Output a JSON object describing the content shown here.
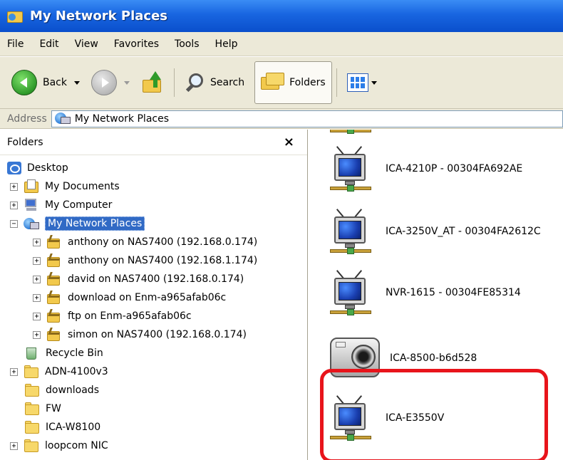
{
  "window": {
    "title": "My Network Places"
  },
  "menu": {
    "items": [
      "File",
      "Edit",
      "View",
      "Favorites",
      "Tools",
      "Help"
    ]
  },
  "toolbar": {
    "back_label": "Back",
    "search_label": "Search",
    "folders_label": "Folders"
  },
  "address": {
    "label": "Address",
    "value": "My Network Places"
  },
  "folders_pane": {
    "title": "Folders",
    "close_glyph": "×",
    "tree": [
      {
        "label": "Desktop",
        "icon": "desktop-icon",
        "expander": "",
        "selected": false
      },
      {
        "label": "My Documents",
        "icon": "my-documents-icon",
        "expander": "+",
        "selected": false
      },
      {
        "label": "My Computer",
        "icon": "my-computer-icon",
        "expander": "+",
        "selected": false
      },
      {
        "label": "My Network Places",
        "icon": "my-network-places-icon",
        "expander": "−",
        "selected": true
      },
      {
        "label": "anthony on NAS7400 (192.168.0.174)",
        "icon": "network-share-icon",
        "expander": "+",
        "selected": false
      },
      {
        "label": "anthony on NAS7400 (192.168.1.174)",
        "icon": "network-share-icon",
        "expander": "+",
        "selected": false
      },
      {
        "label": "david on NAS7400 (192.168.0.174)",
        "icon": "network-share-icon",
        "expander": "+",
        "selected": false
      },
      {
        "label": "download on Enm-a965afab06c",
        "icon": "network-share-icon",
        "expander": "+",
        "selected": false
      },
      {
        "label": "ftp on Enm-a965afab06c",
        "icon": "network-share-icon",
        "expander": "+",
        "selected": false
      },
      {
        "label": "simon on NAS7400 (192.168.0.174)",
        "icon": "network-share-icon",
        "expander": "+",
        "selected": false
      },
      {
        "label": "Recycle Bin",
        "icon": "recycle-bin-icon",
        "expander": "",
        "selected": false
      },
      {
        "label": "ADN-4100v3",
        "icon": "folder-icon",
        "expander": "+",
        "selected": false
      },
      {
        "label": "downloads",
        "icon": "folder-icon",
        "expander": "",
        "selected": false
      },
      {
        "label": "FW",
        "icon": "folder-icon",
        "expander": "",
        "selected": false
      },
      {
        "label": "ICA-W8100",
        "icon": "folder-icon",
        "expander": "",
        "selected": false
      },
      {
        "label": "loopcom NIC",
        "icon": "folder-icon",
        "expander": "+",
        "selected": false
      }
    ]
  },
  "content": {
    "devices": [
      {
        "label": "ICA-4210P - 00304FA692AE",
        "icon": "network-camera-icon"
      },
      {
        "label": "ICA-3250V_AT - 00304FA2612C",
        "icon": "network-camera-icon"
      },
      {
        "label": "NVR-1615 - 00304FE85314",
        "icon": "network-camera-icon"
      },
      {
        "label": "ICA-8500-b6d528",
        "icon": "camera-icon"
      },
      {
        "label": "ICA-E3550V",
        "icon": "network-camera-icon"
      }
    ]
  },
  "colors": {
    "title_bar": "#0a4fcc",
    "selection": "#316ac5",
    "highlight_box": "#e8141b",
    "chrome": "#ece9d8"
  }
}
